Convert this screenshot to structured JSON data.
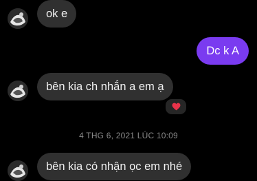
{
  "thread": {
    "messages": [
      {
        "direction": "incoming",
        "text": "ok e"
      },
      {
        "direction": "outgoing",
        "text": "Dc k A"
      },
      {
        "direction": "incoming",
        "text": "bên kia ch nhắn a em ạ",
        "reaction": "heart"
      },
      {
        "direction": "incoming",
        "text": "bên kia có nhận ọc em nhé"
      }
    ],
    "timestamp": "4 THG 6, 2021 LÚC 10:09"
  },
  "colors": {
    "background": "#000000",
    "incoming_bubble": "#303030",
    "outgoing_bubble": "#7a3bf0",
    "timestamp_text": "#8a8a8a",
    "reaction_heart": "#e8334a"
  },
  "icons": {
    "avatar": "avatar-icon",
    "reaction": "heart-icon"
  }
}
